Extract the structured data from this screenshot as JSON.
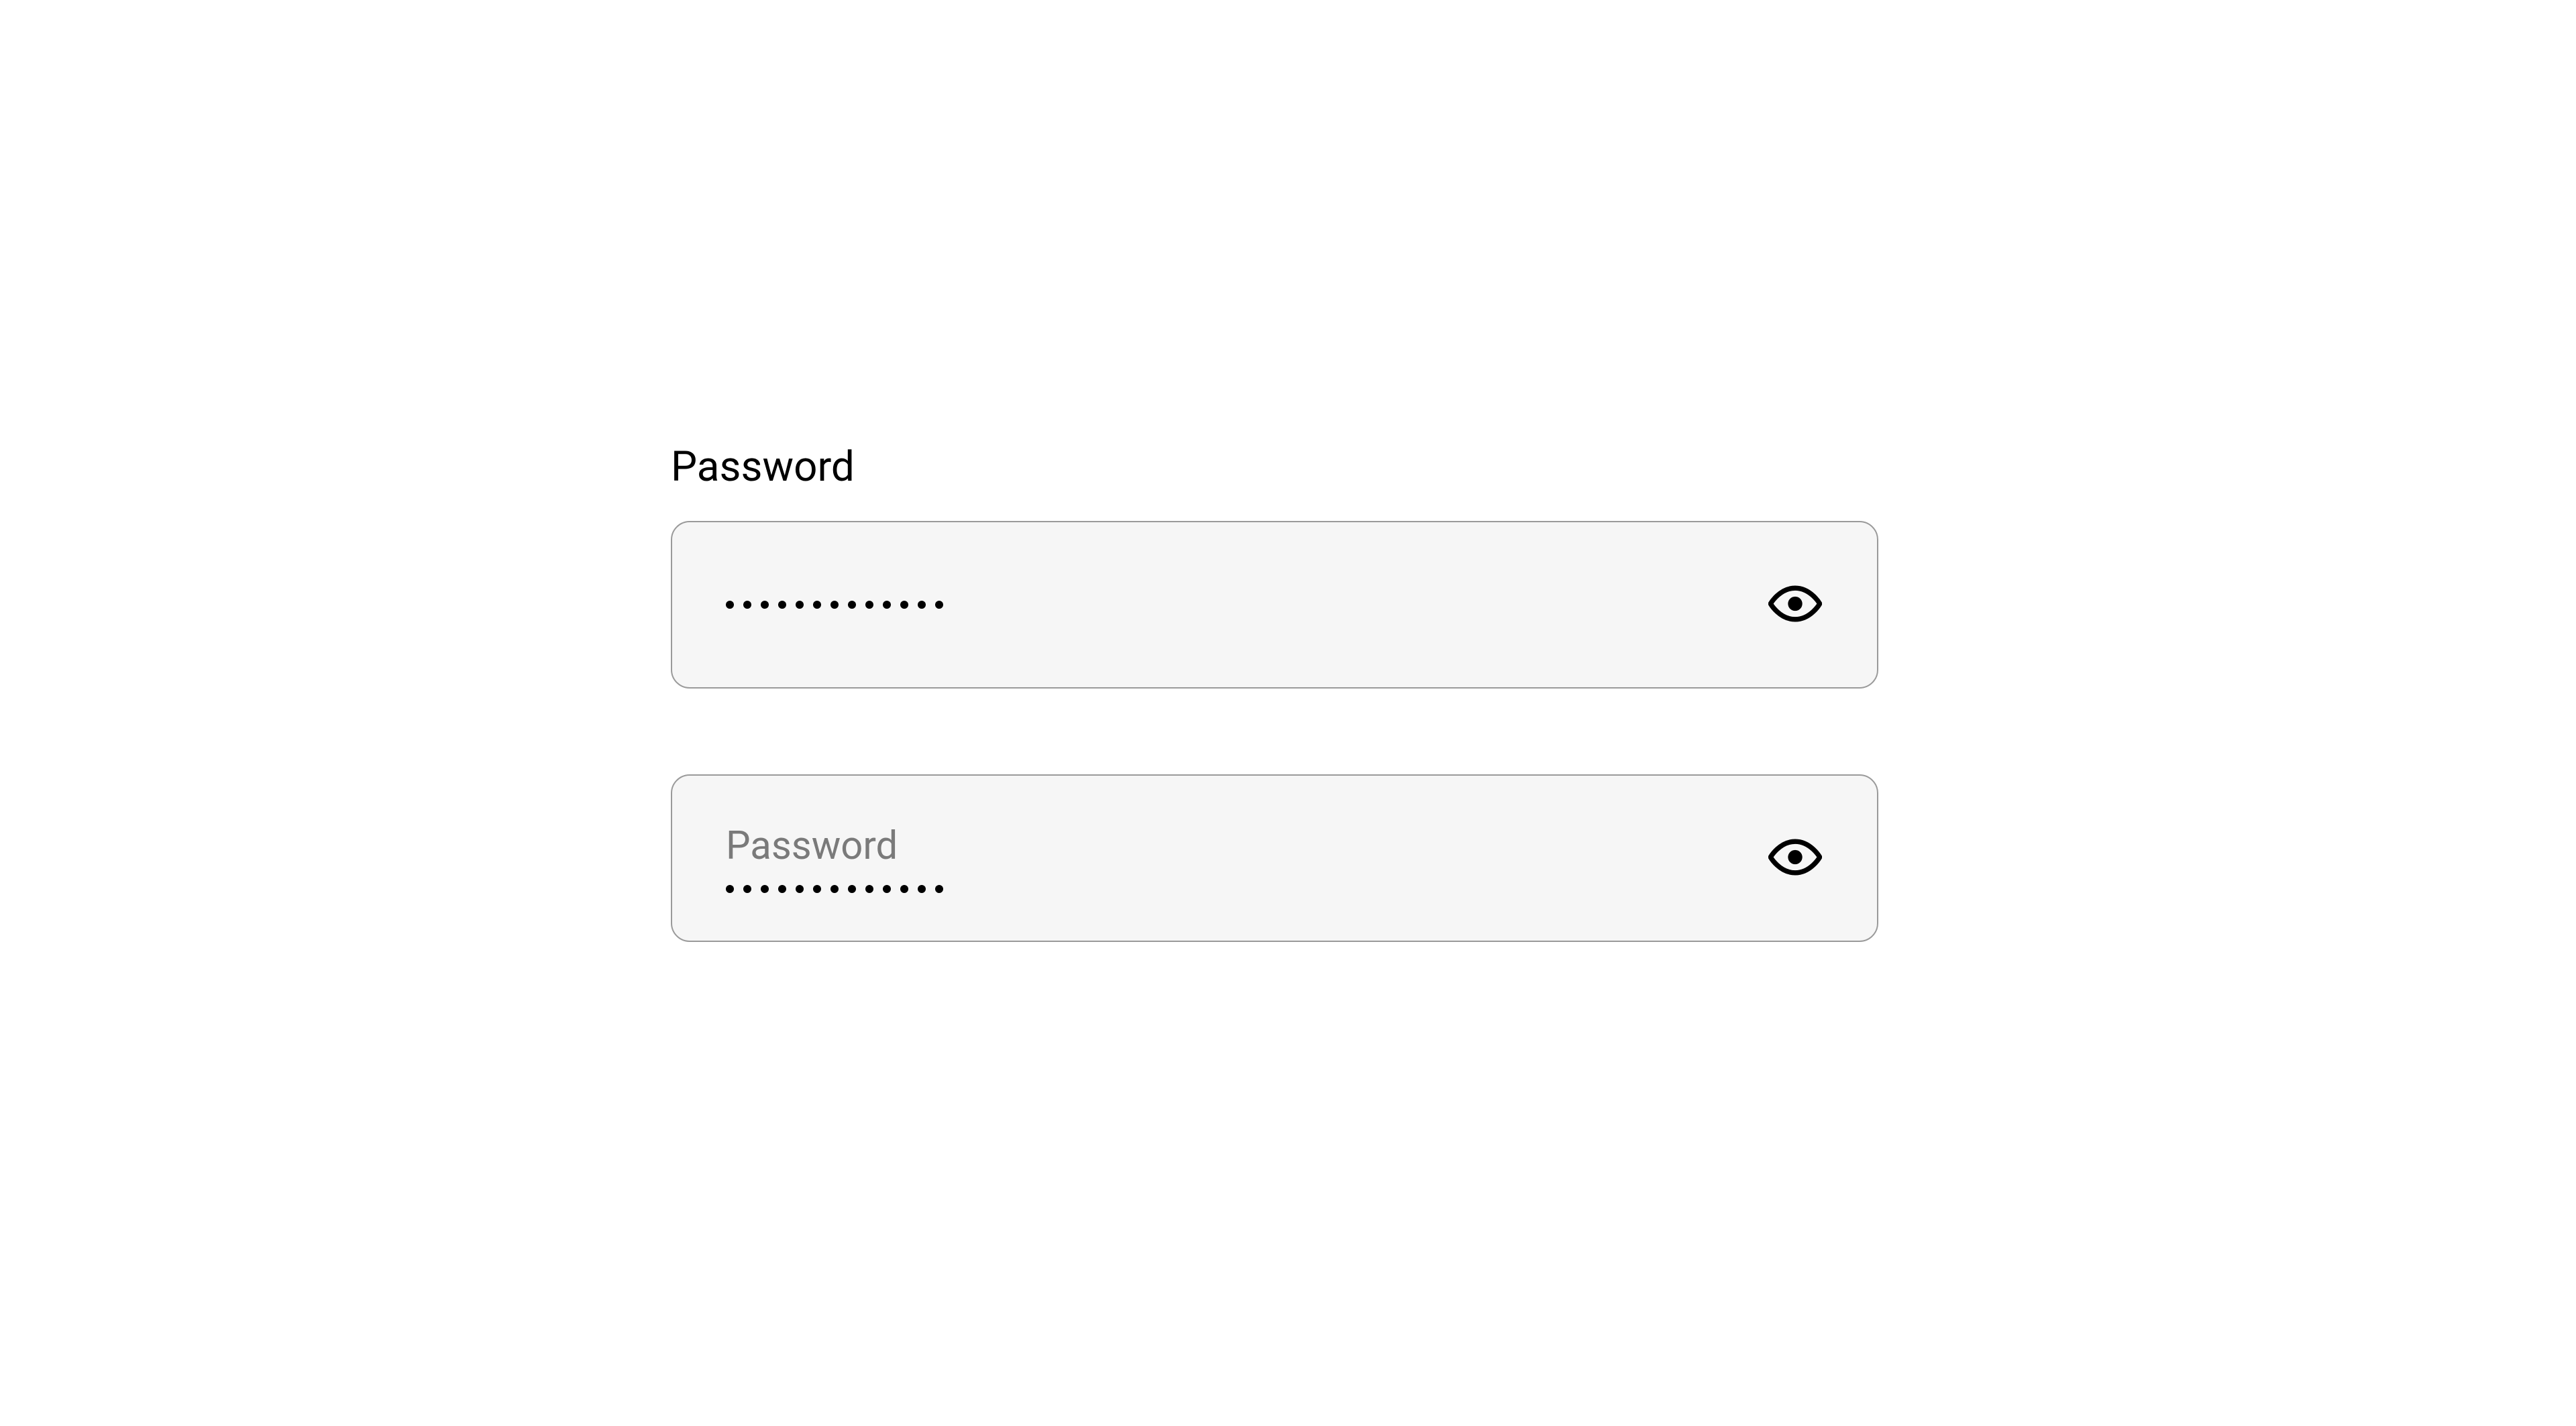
{
  "fields": [
    {
      "label": "Password",
      "label_position": "external",
      "masked_length": 13,
      "toggle_icon": "eye-icon"
    },
    {
      "label": "Password",
      "label_position": "internal",
      "masked_length": 13,
      "toggle_icon": "eye-icon"
    }
  ]
}
